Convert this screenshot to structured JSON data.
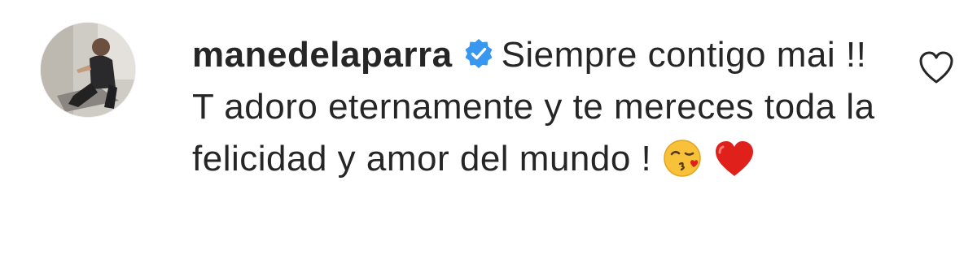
{
  "comment": {
    "username": "manedelaparra",
    "verified": true,
    "text": "Siempre contigo mai !! T adoro eternamente y te mereces toda la felicidad y amor del mundo !",
    "emojis": [
      "face-blowing-kiss-emoji",
      "red-heart-emoji"
    ]
  },
  "icons": {
    "verified": "verified-badge-icon",
    "like": "heart-outline-icon"
  },
  "colors": {
    "verified_blue": "#3897f0",
    "text": "#262626",
    "heart_red": "#e0201b"
  }
}
